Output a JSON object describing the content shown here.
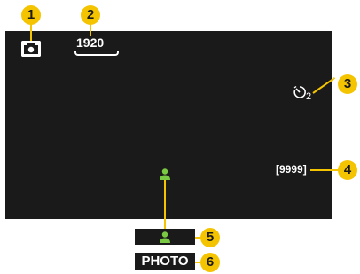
{
  "screen": {
    "mode_icon": "camera-icon",
    "resolution": "1920",
    "self_timer_icon": "self-timer-icon",
    "self_timer_value": "2",
    "remaining_count": "[9999]",
    "face_icon": "person-icon",
    "mode_label": "PHOTO"
  },
  "callouts": [
    "1",
    "2",
    "3",
    "4",
    "5",
    "6"
  ],
  "colors": {
    "callout": "#f5c400",
    "screen_bg": "#1a1a1a",
    "face_icon": "#7ac943"
  }
}
